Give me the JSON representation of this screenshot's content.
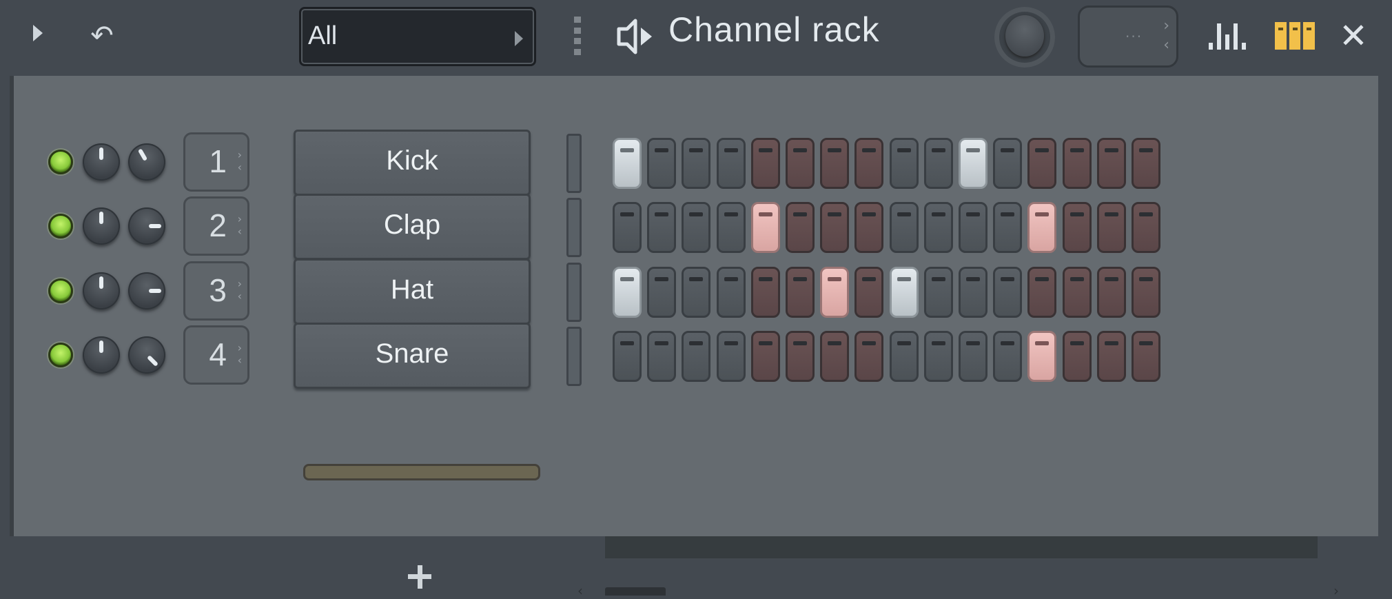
{
  "toolbar": {
    "filter_value": "All",
    "title": "Channel rack",
    "icons": {
      "menu_arrow": "play-triangle-icon",
      "undo": "undo-arrow-icon",
      "drag": "drag-handle-icon",
      "speaker": "speaker-icon",
      "swing": "swing-knob",
      "steps": "steps-spinner",
      "graph": "graph-editor-icon",
      "pattern": "step-sequencer-icon",
      "close": "close-icon"
    },
    "steps_spinner_text": "···",
    "undo_glyph": "↶",
    "close_glyph": "✕"
  },
  "colors": {
    "led_on": "#9be04a",
    "step_on_white": "#dfe5e9",
    "step_on_pink": "#ebbab7",
    "pattern_icon": "#f2c04a"
  },
  "channels": [
    {
      "name": "Kick",
      "number": "1",
      "volume_angle": 0,
      "pan_angle": -30,
      "steps": [
        1,
        0,
        0,
        0,
        0,
        0,
        0,
        0,
        0,
        0,
        1,
        0,
        0,
        0,
        0,
        0
      ]
    },
    {
      "name": "Clap",
      "number": "2",
      "volume_angle": 0,
      "pan_angle": 90,
      "steps": [
        0,
        0,
        0,
        0,
        1,
        0,
        0,
        0,
        0,
        0,
        0,
        0,
        1,
        0,
        0,
        0
      ]
    },
    {
      "name": "Hat",
      "number": "3",
      "volume_angle": 0,
      "pan_angle": 90,
      "steps": [
        1,
        0,
        0,
        0,
        0,
        0,
        1,
        0,
        1,
        0,
        0,
        0,
        0,
        0,
        0,
        0
      ]
    },
    {
      "name": "Snare",
      "number": "4",
      "volume_angle": 0,
      "pan_angle": 135,
      "steps": [
        0,
        0,
        0,
        0,
        0,
        0,
        0,
        0,
        0,
        0,
        0,
        0,
        1,
        0,
        0,
        0
      ]
    }
  ],
  "spinner_chevrons": {
    "up": "›",
    "down": "‹"
  },
  "footer": {
    "add_channel": "add-channel-icon",
    "scroll_left": "‹",
    "scroll_right": "›"
  }
}
